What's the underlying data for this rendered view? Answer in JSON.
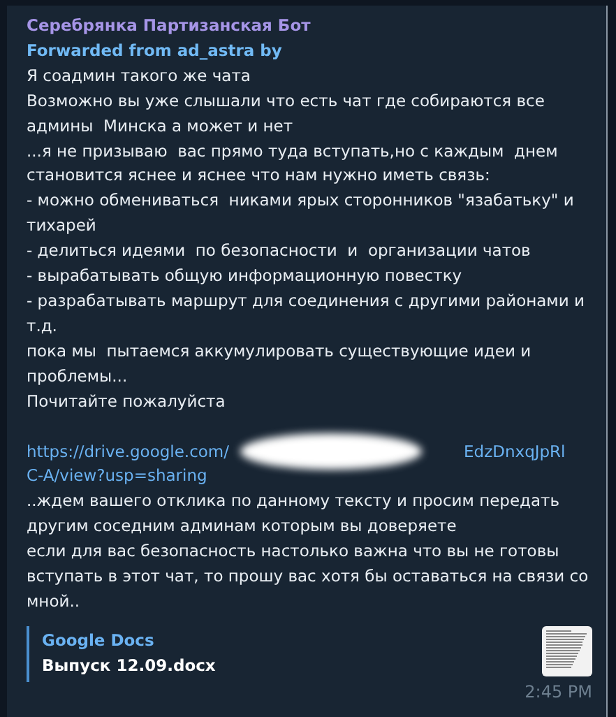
{
  "message": {
    "sender": "Серебрянка Партизанская Бот",
    "forwarded": "Forwarded from ad_astra by",
    "paragraphs_before": [
      "Я соадмин такого же чата",
      "Возможно вы уже слышали что есть чат где собираются все админы  Минска а может и нет",
      "...я не призываю  вас прямо туда вступать,но с каждым  днем становится яснее и яснее что нам нужно иметь связь:",
      "- можно обмениваться  никами ярых сторонников \"язабатьку\" и тихарей",
      "- делиться идеями  по безопасности  и  организации чатов",
      "- вырабатывать общую информационную повестку",
      "- разрабатывать маршрут для соединения с другими районами и т.д.",
      "пока мы  пытаемся аккумулировать существующие идеи и проблемы...",
      "Почитайте пожалуйста"
    ],
    "link": {
      "start": "https://drive.google.com/",
      "end": "EdzDnxqJpRl",
      "second_line": "C-A/view?usp=sharing",
      "redacted": true
    },
    "paragraphs_after": [
      "..ждем вашего отклика по данному тексту и просим передать другим соседним админам которым вы доверяете",
      "если для вас безопасность настолько важна что вы не готовы вступать в этот чат, то прошу вас хотя бы оставаться на связи со мной.."
    ],
    "preview": {
      "site": "Google Docs",
      "title": "Выпуск 12.09.docx"
    },
    "time": "2:45 PM"
  }
}
